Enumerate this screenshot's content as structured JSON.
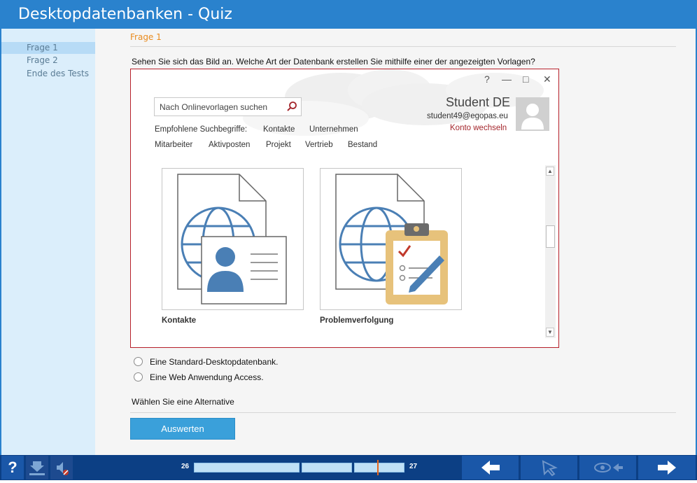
{
  "window": {
    "title": "Desktopdatenbanken - Quiz"
  },
  "sidebar": {
    "items": [
      {
        "label": "Frage  1"
      },
      {
        "label": "Frage  2"
      },
      {
        "label": "Ende des Tests"
      }
    ]
  },
  "main": {
    "question_title": "Frage  1",
    "question_text": "Sehen Sie sich das Bild an. Welche Art der Datenbank erstellen Sie mithilfe einer der angezeigten Vorlagen?",
    "screenshot": {
      "window_controls": [
        "?",
        "—",
        "□",
        "✕"
      ],
      "search_placeholder": "Nach Onlinevorlagen suchen",
      "suggestions_label": "Empfohlene Suchbegriffe:",
      "suggestions": [
        "Kontakte",
        "Unternehmen",
        "Mitarbeiter",
        "Aktivposten",
        "Projekt",
        "Vertrieb",
        "Bestand"
      ],
      "user": {
        "name": "Student DE",
        "email": "student49@egopas.eu",
        "switch_account": "Konto wechseln"
      },
      "templates": [
        {
          "label": "Kontakte",
          "icon": "contacts-template-icon"
        },
        {
          "label": "Problemverfolgung",
          "icon": "issue-tracking-template-icon"
        }
      ]
    },
    "options": [
      {
        "label": "Eine Standard-Desktopdatenbank."
      },
      {
        "label": "Eine Web Anwendung Access."
      }
    ],
    "hint": "Wählen Sie eine Alternative",
    "evaluate_label": "Auswerten"
  },
  "bottombar": {
    "help_label": "?",
    "page_start": "26",
    "page_end": "27",
    "icons": [
      "help-icon",
      "download-icon",
      "mute-icon",
      "back-arrow-icon",
      "pointer-icon",
      "eye-arrow-icon",
      "forward-arrow-icon"
    ]
  },
  "colors": {
    "titlebar": "#2a82cd",
    "sidebar": "#dbeefb",
    "accent_orange": "#e98b1e",
    "accent_red": "#a4262c",
    "button_blue": "#3aa0da",
    "bottombar": "#0c3f84"
  }
}
